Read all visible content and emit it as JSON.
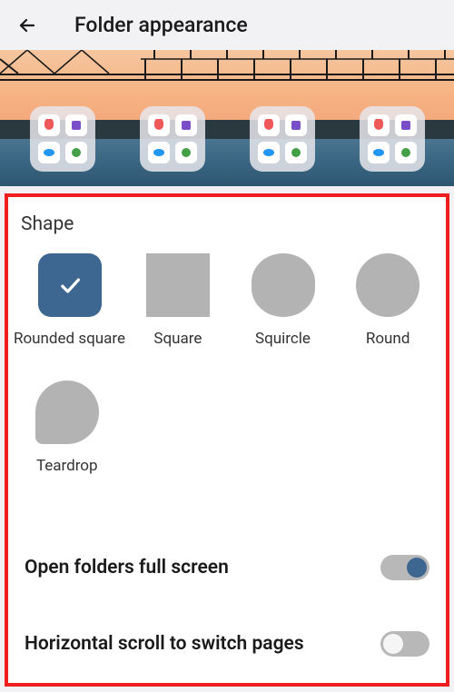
{
  "header": {
    "title": "Folder appearance"
  },
  "sections": {
    "shape": {
      "title": "Shape",
      "options": [
        {
          "label": "Rounded square",
          "selected": true
        },
        {
          "label": "Square",
          "selected": false
        },
        {
          "label": "Squircle",
          "selected": false
        },
        {
          "label": "Round",
          "selected": false
        },
        {
          "label": "Teardrop",
          "selected": false
        }
      ]
    }
  },
  "settings": {
    "fullScreen": {
      "label": "Open folders full screen",
      "enabled": true
    },
    "horizontalScroll": {
      "label": "Horizontal scroll to switch pages",
      "enabled": false
    }
  },
  "colors": {
    "accent": "#3d6690",
    "highlightBorder": "#ef1f1f",
    "swatchInactive": "#b3b3b3"
  },
  "icons": {
    "back": "back-arrow-icon",
    "check": "checkmark-icon"
  }
}
